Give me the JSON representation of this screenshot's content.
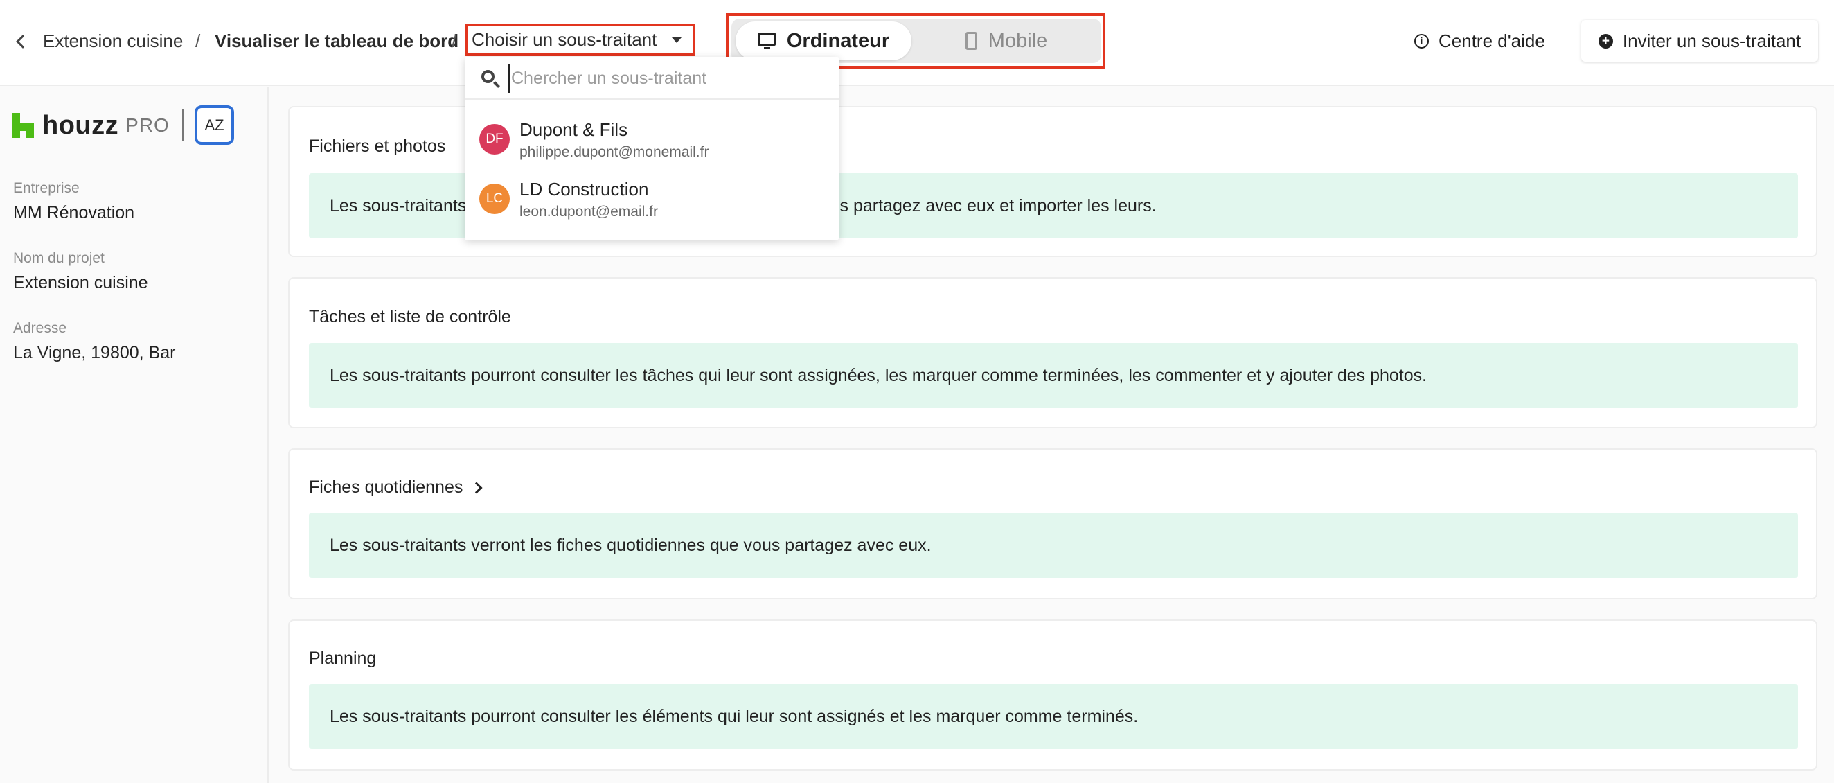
{
  "header": {
    "back_label": "Extension cuisine",
    "separator": "/",
    "current_page": "Visualiser le tableau de bord",
    "subcontractor_picker": "Choisir un sous-traitant",
    "view_modes": {
      "desktop": "Ordinateur",
      "mobile": "Mobile",
      "selected": "desktop"
    },
    "help_label": "Centre d'aide",
    "invite_label": "Inviter un sous-traitant"
  },
  "sidebar": {
    "logo_word": "houzz",
    "logo_pro": "PRO",
    "avatar_initials": "AZ",
    "company_label": "Entreprise",
    "company_value": "MM Rénovation",
    "project_label": "Nom du projet",
    "project_value": "Extension cuisine",
    "address_label": "Adresse",
    "address_value": "La Vigne, 19800, Bar"
  },
  "cards": [
    {
      "title": "Fichiers et photos",
      "text": "Les sous-traitants pourront consulter les fichiers et photos que vous partagez avec eux et importer les leurs."
    },
    {
      "title": "Tâches et liste de contrôle",
      "text": "Les sous-traitants pourront consulter les tâches qui leur sont assignées, les marquer comme terminées, les commenter et y ajouter des photos."
    },
    {
      "title": "Fiches quotidiennes",
      "text": "Les sous-traitants verront les fiches quotidiennes que vous partagez avec eux."
    },
    {
      "title": "Planning",
      "text": "Les sous-traitants pourront consulter les éléments qui leur sont assignés et les marquer comme terminés."
    }
  ],
  "dropdown": {
    "search_placeholder": "Chercher un sous-traitant",
    "items": [
      {
        "initials": "DF",
        "name": "Dupont & Fils",
        "email": "philippe.dupont@monemail.fr",
        "color": "#d93a5b"
      },
      {
        "initials": "LC",
        "name": "LD Construction",
        "email": "leon.dupont@email.fr",
        "color": "#f08a35"
      }
    ]
  },
  "colors": {
    "highlight_outline": "#e2351f",
    "brand_green": "#4dbc15",
    "info_bg": "#e2f7ee",
    "avatar_border": "#2f6fd6"
  }
}
